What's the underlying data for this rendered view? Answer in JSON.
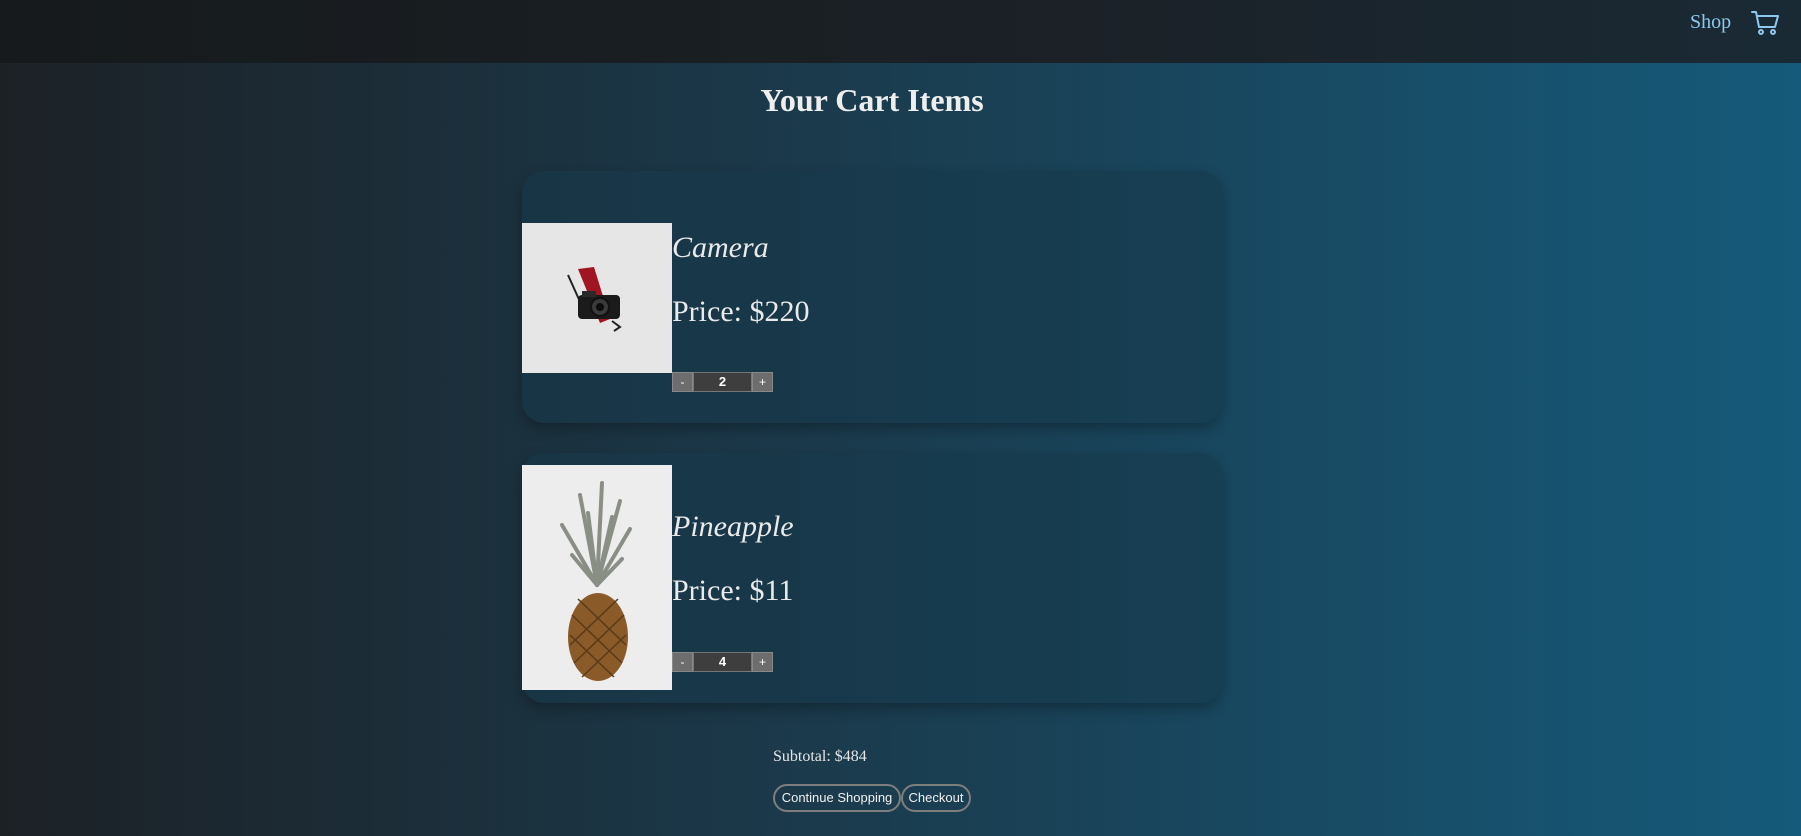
{
  "nav": {
    "shop_label": "Shop",
    "cart_icon": "shopping-cart-icon"
  },
  "page_title": "Your Cart Items",
  "items": [
    {
      "name": "Camera",
      "price_text": "Price: $220",
      "quantity": "2",
      "decrement_label": "-",
      "increment_label": "+"
    },
    {
      "name": "Pineapple",
      "price_text": "Price: $11",
      "quantity": "4",
      "decrement_label": "-",
      "increment_label": "+"
    }
  ],
  "subtotal_text": "Subtotal: $484",
  "actions": {
    "continue_label": "Continue Shopping",
    "checkout_label": "Checkout"
  },
  "colors": {
    "link": "#8ec8ee",
    "background_left": "#1c2126",
    "background_right": "#155a7a"
  }
}
